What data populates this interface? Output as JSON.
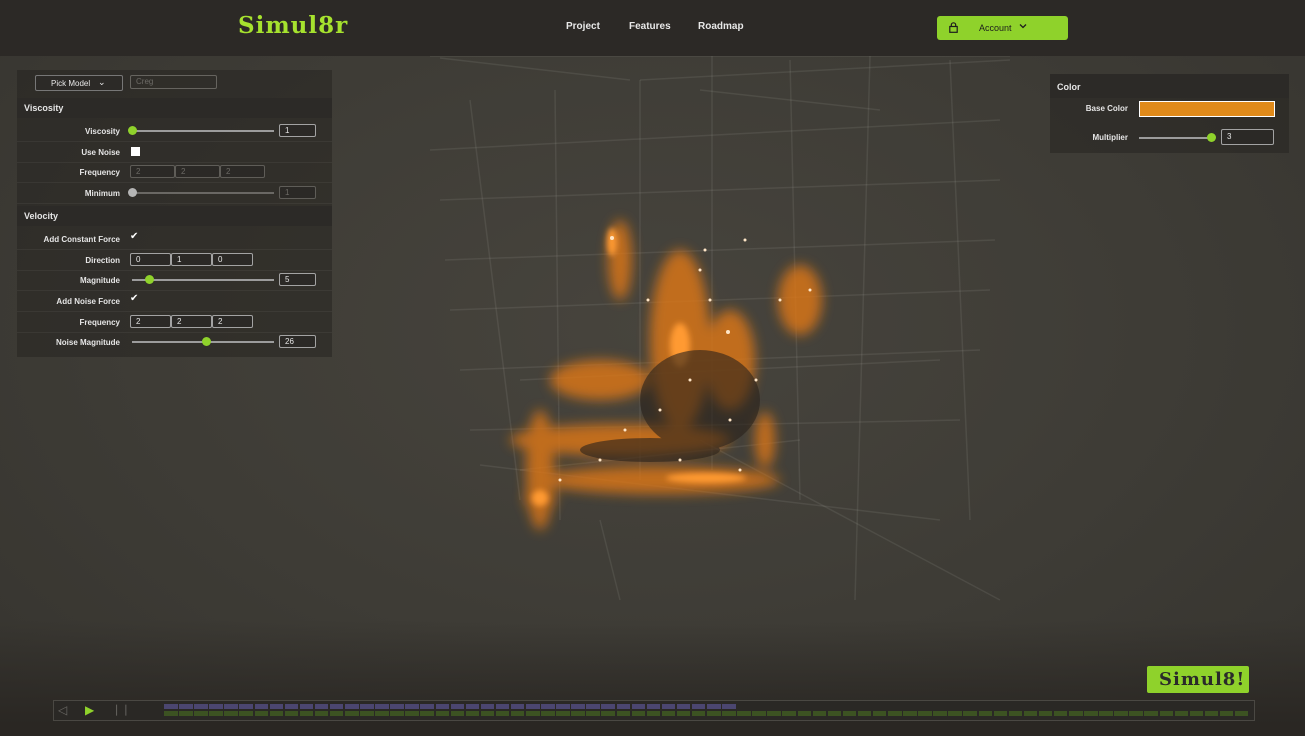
{
  "app": {
    "logo": "Simul8r",
    "brand_color": "#8fd22b",
    "particle_color": "#e08a1a"
  },
  "nav": {
    "items": [
      "Project",
      "Features",
      "Roadmap"
    ]
  },
  "account": {
    "label": "Account",
    "icon": "lock-icon",
    "chevron": "chevron-down-icon"
  },
  "model": {
    "pick_label": "Pick Model",
    "input_placeholder": "Creg"
  },
  "viscosity": {
    "title": "Viscosity",
    "viscosity_label": "Viscosity",
    "viscosity_value": "1",
    "viscosity_slider": 0.0,
    "use_noise_label": "Use Noise",
    "use_noise": false,
    "frequency_label": "Frequency",
    "frequency": [
      "2",
      "2",
      "2"
    ],
    "minimum_label": "Minimum",
    "minimum_value": "1",
    "minimum_slider": 0.0
  },
  "velocity": {
    "title": "Velocity",
    "constant_force_label": "Add Constant Force",
    "constant_force": true,
    "direction_label": "Direction",
    "direction": [
      "0",
      "1",
      "0"
    ],
    "magnitude_label": "Magnitude",
    "magnitude_value": "5",
    "magnitude_slider": 0.12,
    "noise_force_label": "Add Noise Force",
    "noise_force": true,
    "frequency_label": "Frequency",
    "frequency": [
      "2",
      "2",
      "2"
    ],
    "noise_magnitude_label": "Noise Magnitude",
    "noise_magnitude_value": "26",
    "noise_magnitude_slider": 0.52
  },
  "color": {
    "title": "Color",
    "base_color_label": "Base Color",
    "base_color": "#e08a1a",
    "multiplier_label": "Multiplier",
    "multiplier_value": "3",
    "multiplier_slider": 0.95
  },
  "timeline": {
    "total_frames": 72,
    "buffered_frames": 38,
    "play_icon": "play-icon",
    "back_icon": "step-back-icon",
    "pause_icon": "pause-icon"
  },
  "badge": {
    "label": "Simul8!"
  }
}
